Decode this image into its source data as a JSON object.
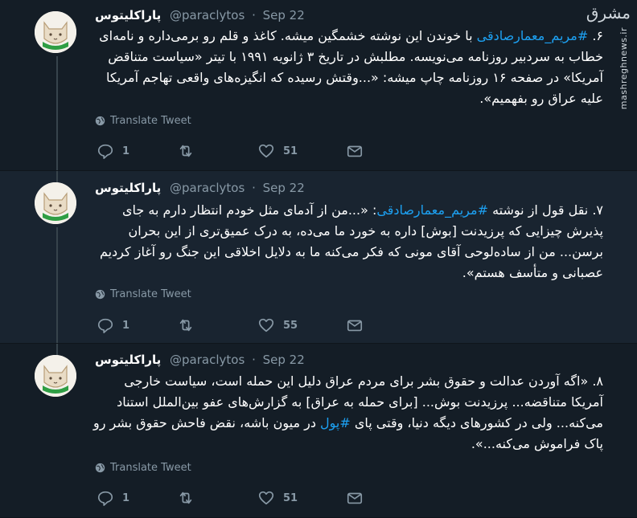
{
  "watermark": {
    "brand": "مشرق",
    "url": "mashreghnews.ir"
  },
  "tweets": [
    {
      "author": {
        "name": "پاراکلیتوس",
        "handle": "@paraclytos"
      },
      "dot": "·",
      "date": "Sep 22",
      "text_before": "۶. ",
      "tag": "#مریم_معمارصادقی",
      "text_after": " با خوندن این نوشته خشمگین میشه. کاغذ و قلم رو برمی‌داره و نامه‌ای خطاب به سردبیر روزنامه می‌نویسه. مطلبش در تاریخ ۳ ژانویه ۱۹۹۱ با تیتر «سیاست متناقض آمریکا» در صفحه ۱۶ روزنامه چاپ میشه: «...وقتش رسیده که انگیزه‌های واقعی تهاجم آمریکا علیه عراق رو بفهمیم».",
      "translate": "Translate Tweet",
      "replies": "1",
      "retweets": "",
      "likes": "51"
    },
    {
      "author": {
        "name": "پاراکلیتوس",
        "handle": "@paraclytos"
      },
      "dot": "·",
      "date": "Sep 22",
      "text_before": "۷. نقل قول از نوشته ",
      "tag": "#مریم_معمارصادقی",
      "text_after": ": «...من از آدمای مثل خودم انتظار دارم به جای پذیرش چیزایی که پرزیدنت [بوش] داره به خورد ما می‌ده، به درک عمیق‌تری از این بحران برسن... من از ساده‌لوحی آقای مونی که فکر می‌کنه ما به دلایل اخلاقی این جنگ رو آغاز کردیم عصبانی و متأسف هستم».",
      "translate": "Translate Tweet",
      "replies": "1",
      "retweets": "",
      "likes": "55"
    },
    {
      "author": {
        "name": "پاراکلیتوس",
        "handle": "@paraclytos"
      },
      "dot": "·",
      "date": "Sep 22",
      "text_before": "۸. «اگه آوردن عدالت و حقوق بشر برای مردم عراق دلیل این حمله است، سیاست خارجی آمریکا متناقضه... پرزیدنت بوش... [برای حمله به عراق] به گزارش‌های عفو بین‌الملل استناد می‌کنه... ولی در کشورهای دیگه دنیا، وقتی پای ",
      "tag": "#پول",
      "text_after": " در میون باشه، نقض فاحش حقوق بشر رو پاک فراموش می‌کنه...».",
      "translate": "Translate Tweet",
      "replies": "1",
      "retweets": "",
      "likes": "51"
    }
  ]
}
